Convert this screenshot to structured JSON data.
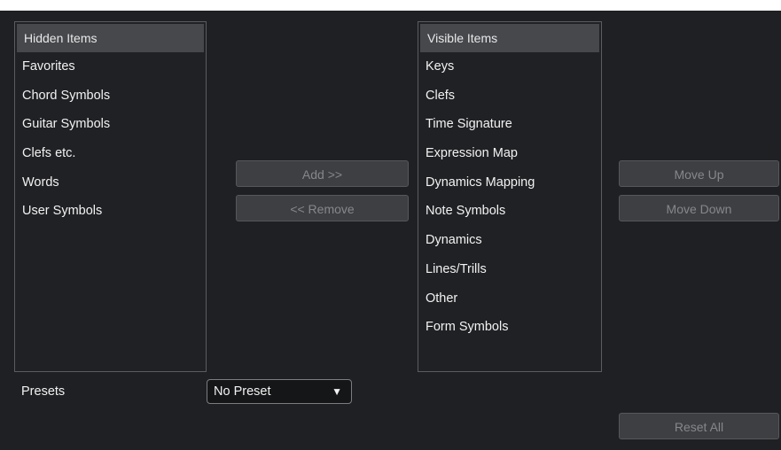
{
  "hidden_panel": {
    "header": "Hidden Items",
    "items": [
      "Favorites",
      "Chord Symbols",
      "Guitar Symbols",
      "Clefs etc.",
      "Words",
      "User Symbols"
    ]
  },
  "visible_panel": {
    "header": "Visible Items",
    "items": [
      "Keys",
      "Clefs",
      "Time Signature",
      "Expression Map",
      "Dynamics Mapping",
      "Note Symbols",
      "Dynamics",
      "Lines/Trills",
      "Other",
      "Form Symbols"
    ]
  },
  "buttons": {
    "add": "Add >>",
    "remove": "<< Remove",
    "move_up": "Move Up",
    "move_down": "Move Down",
    "reset_all": "Reset All"
  },
  "presets": {
    "label": "Presets",
    "value": "No Preset",
    "arrow_icon": "▼"
  }
}
